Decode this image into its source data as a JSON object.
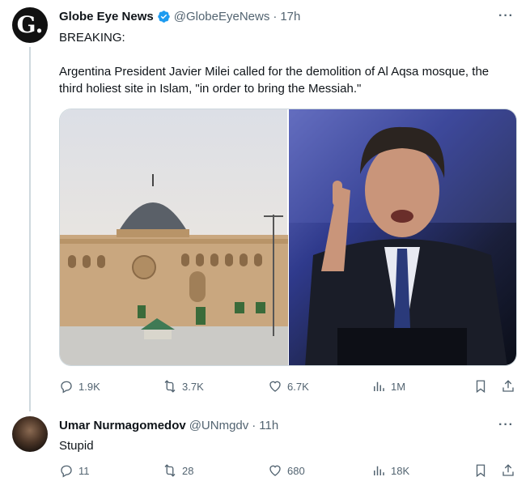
{
  "tweets": [
    {
      "author": {
        "name": "Globe Eye News",
        "handle": "@GlobeEyeNews",
        "avatar_letter": "G."
      },
      "time": "17h",
      "more": "···",
      "text_lines": [
        "BREAKING:",
        "Argentina President Javier Milei called for the demolition of Al Aqsa mosque, the third holiest site in Islam, \"in order to bring the Messiah.\""
      ],
      "metrics": {
        "replies": "1.9K",
        "reposts": "3.7K",
        "likes": "6.7K",
        "views": "1M"
      }
    },
    {
      "author": {
        "name": "Umar Nurmagomedov",
        "handle": "@UNmgdv"
      },
      "time": "11h",
      "more": "···",
      "text": "Stupid",
      "metrics": {
        "replies": "11",
        "reposts": "28",
        "likes": "680",
        "views": "18K"
      }
    }
  ],
  "separator": "·",
  "colors": {
    "verified": "#1d9bf0",
    "secondary_text": "#536471",
    "thread_line": "#cfd9de"
  }
}
